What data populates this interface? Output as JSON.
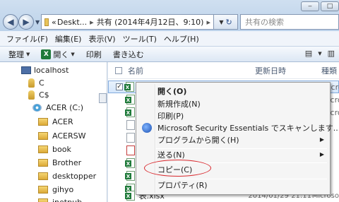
{
  "window": {
    "minimize_label": "‒",
    "maximize_label": "□"
  },
  "address": {
    "prefix": "«",
    "crumb1": "Deskt...",
    "crumb2": "共有 (2014年4月12日、9:10)",
    "refresh_icon": "↻"
  },
  "search": {
    "placeholder": "共有の検索"
  },
  "menubar": {
    "file": "ファイル(F)",
    "edit": "編集(E)",
    "view": "表示(V)",
    "tools": "ツール(T)",
    "help": "ヘルプ(H)"
  },
  "toolbar": {
    "organize": "整理",
    "open": "開く",
    "print": "印刷",
    "burn": "書き込む"
  },
  "nav": {
    "items": [
      {
        "label": "localhost"
      },
      {
        "label": "C"
      },
      {
        "label": "C$"
      },
      {
        "label": "ACER (C:)"
      },
      {
        "label": "ACER"
      },
      {
        "label": "ACERSW"
      },
      {
        "label": "book"
      },
      {
        "label": "Brother"
      },
      {
        "label": "desktopper"
      },
      {
        "label": "gihyo"
      },
      {
        "label": "inetpub"
      }
    ]
  },
  "file_list": {
    "col_name": "名前",
    "col_date": "更新日時",
    "col_type": "種類",
    "type_partial": "Microso",
    "last_row_name": "表.xlsx",
    "last_row_date": "2014/01/29 21:11"
  },
  "context_menu": {
    "items": [
      {
        "label": "開く(O)"
      },
      {
        "label": "新規作成(N)"
      },
      {
        "label": "印刷(P)"
      },
      {
        "label": "Microsoft Security Essentials でスキャンします..."
      },
      {
        "label": "プログラムから開く(H)"
      },
      {
        "label": "送る(N)"
      },
      {
        "label": "コピー(C)"
      },
      {
        "label": "プロパティ(R)"
      }
    ]
  },
  "colors": {
    "highlight_circle": "#d9292e",
    "selection": "#d4e6fb"
  }
}
